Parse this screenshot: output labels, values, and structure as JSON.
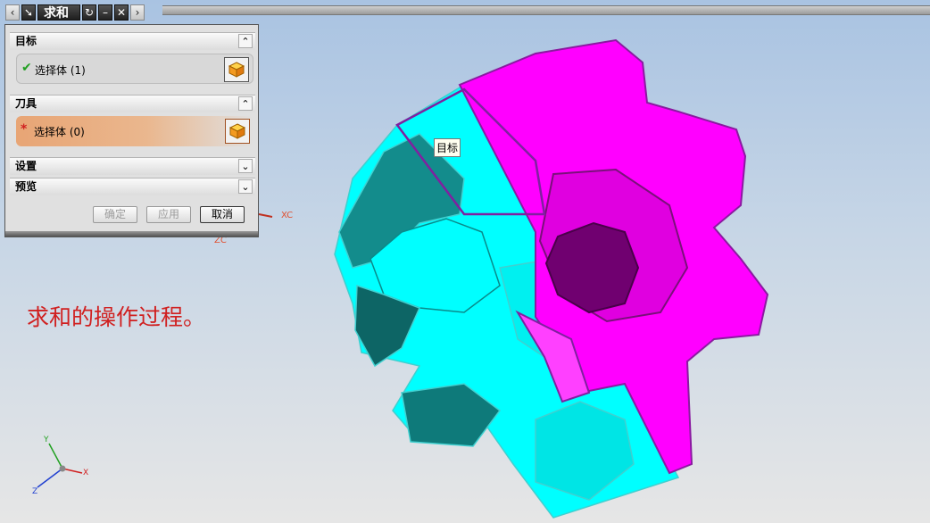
{
  "toolbar": {
    "title": "求和",
    "icons": [
      "chevron-left-icon",
      "arrow-tool-icon",
      "reset-icon",
      "minimize-icon",
      "close-icon",
      "chevron-right-icon"
    ]
  },
  "dialog": {
    "sections": {
      "target": {
        "title": "目标",
        "select_label": "选择体 (1)",
        "status_icon": "check-icon",
        "status_color": "#22a022"
      },
      "tool": {
        "title": "刀具",
        "select_label": "选择体 (0)",
        "status_icon": "asterisk-icon",
        "status_color": "#d02020"
      },
      "settings": {
        "title": "设置"
      },
      "preview": {
        "title": "预览"
      }
    },
    "buttons": {
      "ok": "确定",
      "apply": "应用",
      "cancel": "取消"
    }
  },
  "viewport": {
    "tooltip": "目标",
    "annotation": "求和的操作过程。",
    "wcs_labels": {
      "xc": "XC",
      "zc": "ZC"
    },
    "triad_labels": {
      "x": "X",
      "y": "Y",
      "z": "Z"
    },
    "colors": {
      "target_body": "#ff00ff",
      "tool_body": "#00ffff",
      "annotation": "#d02020"
    }
  }
}
